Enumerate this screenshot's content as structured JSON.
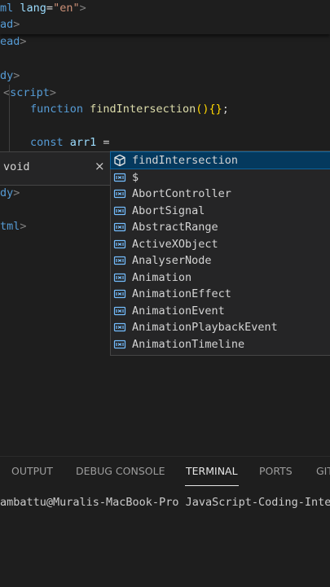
{
  "editor": {
    "lines": [
      {
        "parts": [
          "ml",
          " ",
          "lang",
          "=",
          "\"en\"",
          ">"
        ]
      },
      {
        "parts": [
          "ad",
          ">"
        ]
      },
      {
        "parts": [
          "ead",
          ">"
        ]
      },
      {
        "parts": [
          "dy",
          ">"
        ]
      },
      {
        "parts": [
          "<",
          "script",
          ">"
        ]
      },
      {
        "parts": [
          "function",
          " ",
          "findIntersection",
          "()",
          "{}",
          ";"
        ]
      },
      {
        "parts": [
          "const",
          " ",
          "arr1",
          " ="
        ]
      },
      {
        "parts": [
          "dy",
          ">"
        ]
      },
      {
        "parts": [
          "tml",
          ">"
        ]
      }
    ]
  },
  "hint": {
    "text": "void",
    "close": "×"
  },
  "suggestions": [
    {
      "label": "findIntersection",
      "icon": "cube-icon",
      "selected": true
    },
    {
      "label": "$",
      "icon": "variable-icon"
    },
    {
      "label": "AbortController",
      "icon": "variable-icon"
    },
    {
      "label": "AbortSignal",
      "icon": "variable-icon"
    },
    {
      "label": "AbstractRange",
      "icon": "variable-icon"
    },
    {
      "label": "ActiveXObject",
      "icon": "variable-icon"
    },
    {
      "label": "AnalyserNode",
      "icon": "variable-icon"
    },
    {
      "label": "Animation",
      "icon": "variable-icon"
    },
    {
      "label": "AnimationEffect",
      "icon": "variable-icon"
    },
    {
      "label": "AnimationEvent",
      "icon": "variable-icon"
    },
    {
      "label": "AnimationPlaybackEvent",
      "icon": "variable-icon"
    },
    {
      "label": "AnimationTimeline",
      "icon": "variable-icon"
    }
  ],
  "panel": {
    "tabs": [
      "OUTPUT",
      "DEBUG CONSOLE",
      "TERMINAL",
      "PORTS",
      "GIT"
    ],
    "active_tab": "TERMINAL",
    "terminal_line": "ambattu@Muralis-MacBook-Pro JavaScript-Coding-Interv"
  },
  "colors": {
    "background": "#1e1e1e",
    "tag": "#569cd6",
    "attribute": "#9cdcfe",
    "string": "#ce9178",
    "function": "#dcdcaa",
    "bracket": "#ffd700",
    "selection": "#04395e",
    "icon": "#75beff"
  }
}
